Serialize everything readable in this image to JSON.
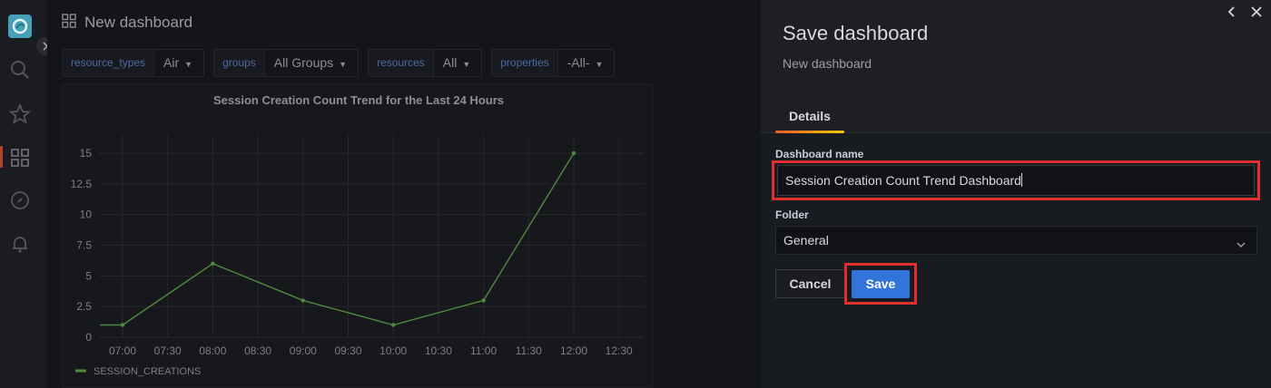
{
  "topbar": {
    "title": "New dashboard"
  },
  "variables": [
    {
      "label": "resource_types",
      "value": "Air"
    },
    {
      "label": "groups",
      "value": "All Groups"
    },
    {
      "label": "resources",
      "value": "All"
    },
    {
      "label": "properties",
      "value": "-All-"
    }
  ],
  "chart_data": {
    "type": "line",
    "title": "Session Creation Count Trend for the Last 24 Hours",
    "x_ticks": [
      "07:00",
      "07:30",
      "08:00",
      "08:30",
      "09:00",
      "09:30",
      "10:00",
      "10:30",
      "11:00",
      "11:30",
      "12:00",
      "12:30"
    ],
    "y_ticks": [
      "0",
      "2.5",
      "5",
      "7.5",
      "10",
      "12.5",
      "15"
    ],
    "ylim": [
      0,
      15
    ],
    "series": [
      {
        "name": "SESSION_CREATIONS",
        "points": [
          {
            "x": "06:45",
            "y": 1
          },
          {
            "x": "07:00",
            "y": 1
          },
          {
            "x": "08:00",
            "y": 6
          },
          {
            "x": "09:00",
            "y": 3
          },
          {
            "x": "10:00",
            "y": 1
          },
          {
            "x": "11:00",
            "y": 3
          },
          {
            "x": "12:00",
            "y": 15
          }
        ]
      }
    ],
    "legend": "bottom-left",
    "grid": true,
    "colors": {
      "line": "#4f8a3e",
      "grid": "#26272c",
      "text": "#7d7e84"
    }
  },
  "drawer": {
    "title": "Save dashboard",
    "subtitle": "New dashboard",
    "tab": "Details",
    "name_label": "Dashboard name",
    "name_value": "Session Creation Count Trend Dashboard",
    "folder_label": "Folder",
    "folder_value": "General",
    "cancel_label": "Cancel",
    "save_label": "Save"
  },
  "colors": {
    "highlight": "#e02f2f",
    "primary": "#3274d9",
    "accent": "#f05a28"
  }
}
